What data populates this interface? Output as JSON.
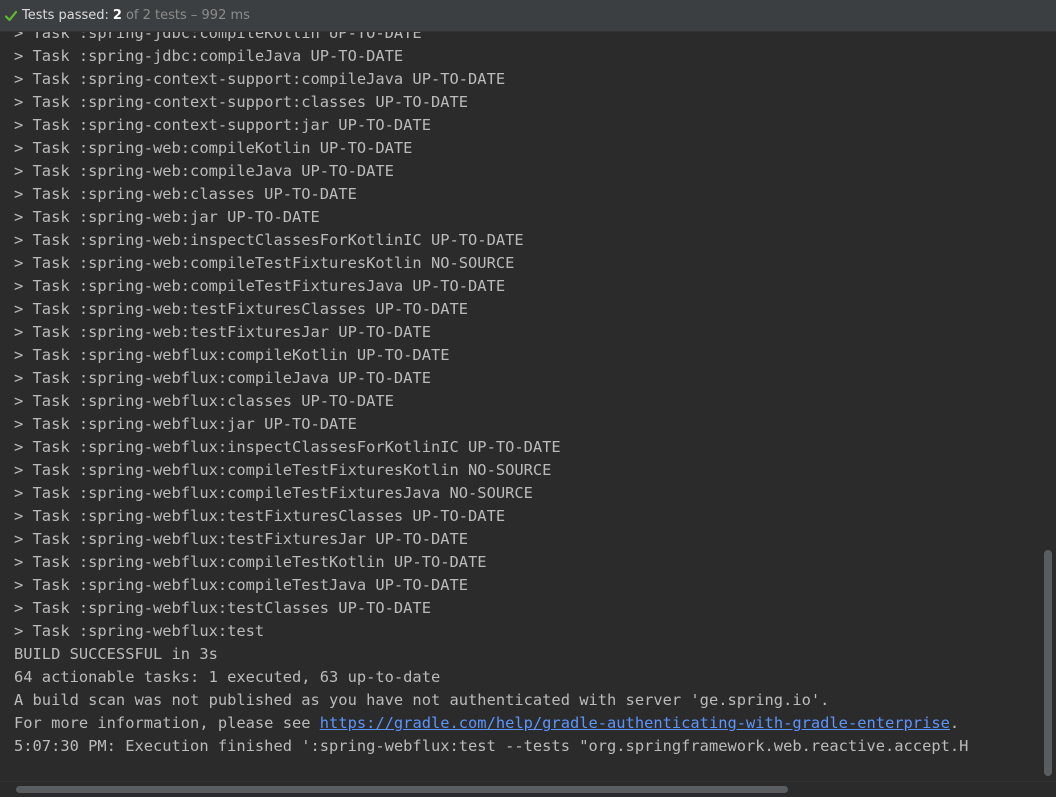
{
  "status": {
    "passed_label": "Tests passed:",
    "passed_count": "2",
    "rest": "of 2 tests – 992 ms",
    "icon": "check-icon",
    "icon_color": "#5fb832"
  },
  "console": {
    "lines": [
      "> Task :spring-jdbc:compileKotlin UP-TO-DATE",
      "> Task :spring-jdbc:compileJava UP-TO-DATE",
      "> Task :spring-context-support:compileJava UP-TO-DATE",
      "> Task :spring-context-support:classes UP-TO-DATE",
      "> Task :spring-context-support:jar UP-TO-DATE",
      "> Task :spring-web:compileKotlin UP-TO-DATE",
      "> Task :spring-web:compileJava UP-TO-DATE",
      "> Task :spring-web:classes UP-TO-DATE",
      "> Task :spring-web:jar UP-TO-DATE",
      "> Task :spring-web:inspectClassesForKotlinIC UP-TO-DATE",
      "> Task :spring-web:compileTestFixturesKotlin NO-SOURCE",
      "> Task :spring-web:compileTestFixturesJava UP-TO-DATE",
      "> Task :spring-web:testFixturesClasses UP-TO-DATE",
      "> Task :spring-web:testFixturesJar UP-TO-DATE",
      "> Task :spring-webflux:compileKotlin UP-TO-DATE",
      "> Task :spring-webflux:compileJava UP-TO-DATE",
      "> Task :spring-webflux:classes UP-TO-DATE",
      "> Task :spring-webflux:jar UP-TO-DATE",
      "> Task :spring-webflux:inspectClassesForKotlinIC UP-TO-DATE",
      "> Task :spring-webflux:compileTestFixturesKotlin NO-SOURCE",
      "> Task :spring-webflux:compileTestFixturesJava NO-SOURCE",
      "> Task :spring-webflux:testFixturesClasses UP-TO-DATE",
      "> Task :spring-webflux:testFixturesJar UP-TO-DATE",
      "> Task :spring-webflux:compileTestKotlin UP-TO-DATE",
      "> Task :spring-webflux:compileTestJava UP-TO-DATE",
      "> Task :spring-webflux:testClasses UP-TO-DATE",
      "> Task :spring-webflux:test",
      "BUILD SUCCESSFUL in 3s",
      "64 actionable tasks: 1 executed, 63 up-to-date",
      "A build scan was not published as you have not authenticated with server 'ge.spring.io'."
    ],
    "info_prefix": "For more information, please see ",
    "info_link": "https://gradle.com/help/gradle-authenticating-with-gradle-enterprise",
    "info_suffix": ".",
    "final_line": "5:07:30 PM: Execution finished ':spring-webflux:test --tests \"org.springframework.web.reactive.accept.H"
  }
}
